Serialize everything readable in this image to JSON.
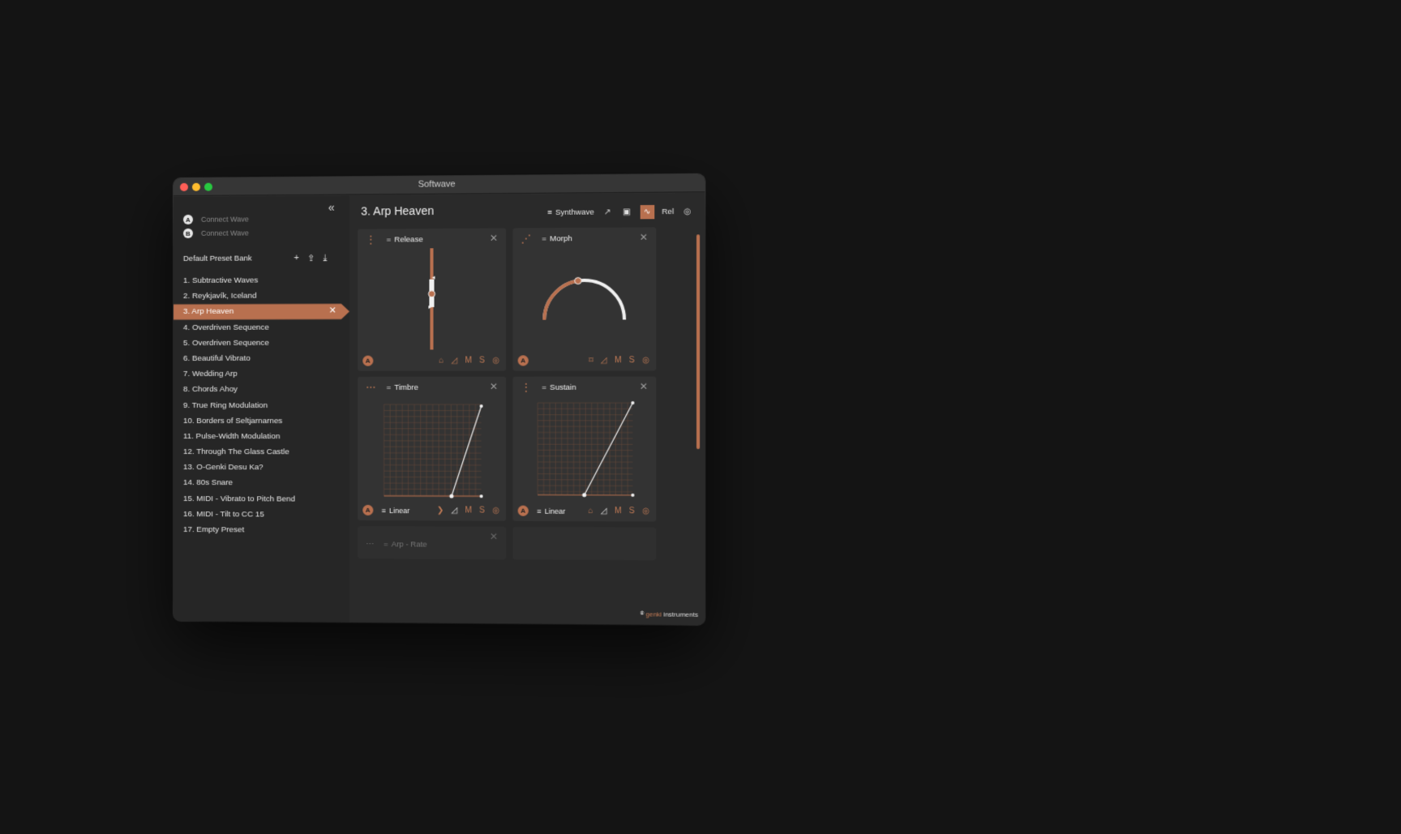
{
  "window": {
    "title": "Softwave"
  },
  "sidebar": {
    "collapse_icon": "double-chevron-left-icon",
    "waves": [
      {
        "badge": "A",
        "label": "Connect Wave"
      },
      {
        "badge": "B",
        "label": "Connect Wave"
      }
    ],
    "bank_title": "Default Preset Bank",
    "bank_tools": {
      "add": "+",
      "export_icon": "share-icon",
      "import_icon": "download-icon"
    },
    "presets": [
      {
        "label": "1.  Subtractive Waves"
      },
      {
        "label": "2.  Reykjavík, Iceland"
      },
      {
        "label": "3.  Arp Heaven",
        "active": true
      },
      {
        "label": "4.  Overdriven Sequence"
      },
      {
        "label": "5.  Overdriven Sequence"
      },
      {
        "label": "6.  Beautiful Vibrato"
      },
      {
        "label": "7.  Wedding Arp"
      },
      {
        "label": "8.  Chords Ahoy"
      },
      {
        "label": "9.  True Ring Modulation"
      },
      {
        "label": "10.  Borders of Seltjarnarnes"
      },
      {
        "label": "11.  Pulse-Width Modulation"
      },
      {
        "label": "12.  Through The Glass Castle"
      },
      {
        "label": "13.  O-Genki Desu Ka?"
      },
      {
        "label": "14.  80s Snare"
      },
      {
        "label": "15.  MIDI - Vibrato to Pitch Bend"
      },
      {
        "label": "16.  MIDI - Tilt to CC 15"
      },
      {
        "label": "17.  Empty Preset"
      }
    ],
    "active_close": "✕"
  },
  "main": {
    "title": "3. Arp Heaven",
    "toolbar": {
      "synth_label": "Synthwave",
      "rel_label": "Rel"
    },
    "cards": {
      "release": {
        "label": "Release",
        "badge": "A",
        "m": "M",
        "s": "S",
        "level": 0.55
      },
      "morph": {
        "label": "Morph",
        "badge": "A",
        "m": "M",
        "s": "S",
        "level": 0.45
      },
      "timbre": {
        "label": "Timbre",
        "badge": "A",
        "curve": "Linear",
        "m": "M",
        "s": "S"
      },
      "sustain": {
        "label": "Sustain",
        "badge": "A",
        "curve": "Linear",
        "m": "M",
        "s": "S"
      },
      "arp_rate": {
        "label": "Arp - Rate"
      }
    },
    "logo": {
      "brand_a": "genki",
      "brand_b": "instruments"
    }
  },
  "colors": {
    "accent": "#b8704f",
    "bg": "#141414",
    "panel": "#333333"
  }
}
